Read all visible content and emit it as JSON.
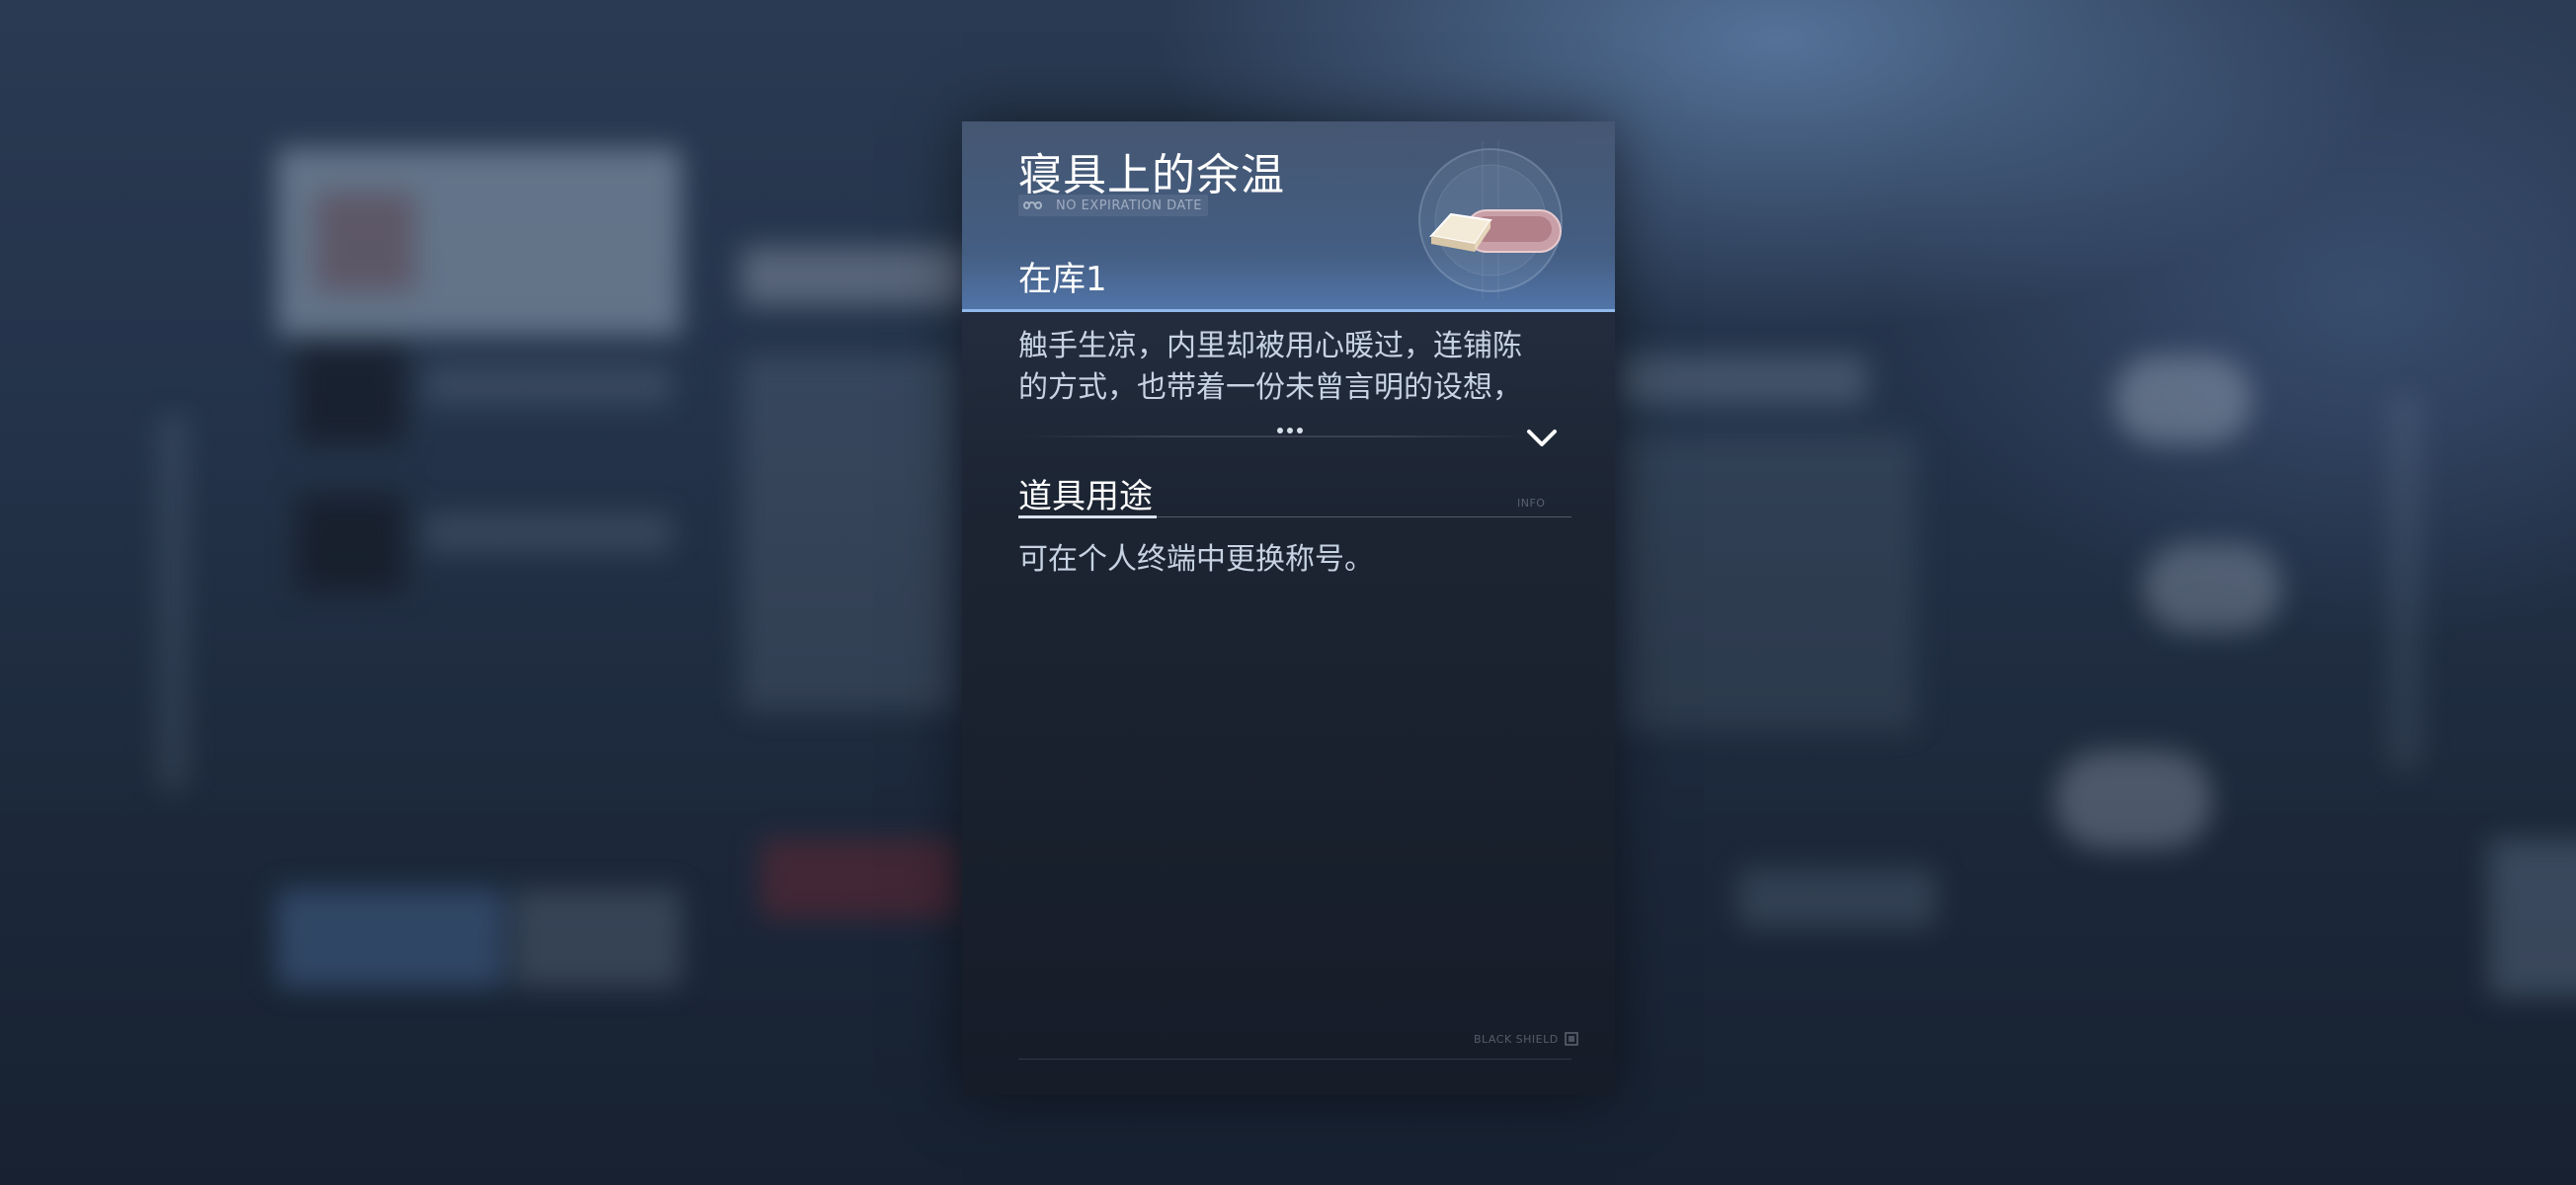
{
  "item": {
    "title": "寝具上的余温",
    "expiry_label": "NO EXPIRATION DATE",
    "expiry_icon": "infinity-icon",
    "stock_label": "在库1",
    "image_icon": "bedding-item-icon"
  },
  "description": {
    "lines": [
      "触手生凉，内里却被用心暖过，连铺陈",
      "的方式，也带着一份未曾言明的设想，"
    ],
    "ellipsis_icon": "more-dots-icon",
    "expand_icon": "chevron-down-icon"
  },
  "usage_section": {
    "title": "道具用途",
    "tag": "INFO",
    "text": "可在个人终端中更换称号。"
  },
  "footer": {
    "brand": "BLACK SHIELD",
    "brand_icon": "brand-square-icon"
  },
  "colors": {
    "accent": "#8fb7ea",
    "header_bg": "#4e6a94",
    "panel_bg": "#1c2432",
    "text_primary": "#ffffff",
    "text_secondary": "#c7d3e2"
  }
}
